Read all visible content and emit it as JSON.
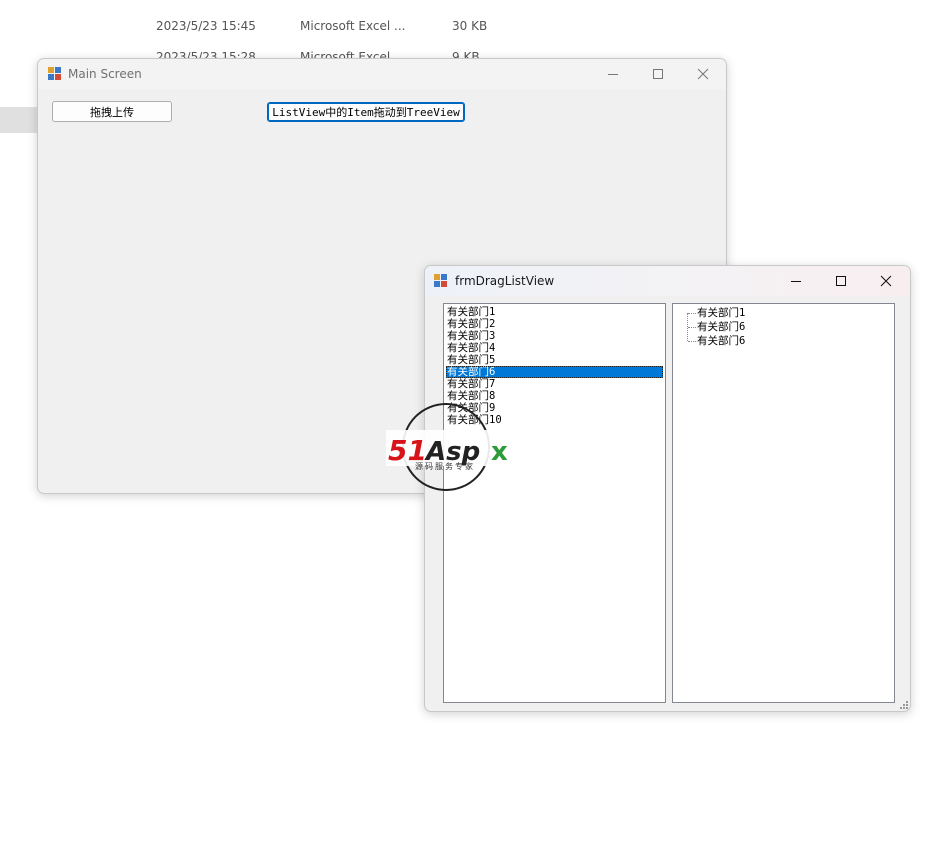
{
  "background_explorer": {
    "rows": [
      {
        "date": "2023/5/23 15:45",
        "type": "Microsoft Excel ...",
        "size": "30 KB"
      },
      {
        "date": "2023/5/23 15:28",
        "type": "Microsoft Excel ...",
        "size": "9 KB"
      }
    ]
  },
  "main_window": {
    "title": "Main Screen",
    "buttons": {
      "drag_upload": "拖拽上传",
      "listview_to_treeview": "ListView中的Item拖动到TreeView"
    }
  },
  "drag_window": {
    "title": "frmDragListView",
    "listview": {
      "items": [
        "有关部门1",
        "有关部门2",
        "有关部门3",
        "有关部门4",
        "有关部门5",
        "有关部门6",
        "有关部门7",
        "有关部门8",
        "有关部门9",
        "有关部门10"
      ],
      "selected_index": 5
    },
    "treeview": {
      "nodes": [
        "有关部门1",
        "有关部门6",
        "有关部门6"
      ]
    }
  },
  "watermark": {
    "logo_text": "51Aspx",
    "tagline": "源码服务专家"
  },
  "colors": {
    "selection": "#0078d7",
    "focus_border": "#0067c0",
    "window_bg": "#f0f0f0",
    "logo_red": "#d7141a",
    "logo_green": "#2e9b3a"
  },
  "icons": {
    "app": "winforms-app-icon",
    "minimize": "minimize-icon",
    "maximize": "maximize-icon",
    "close": "close-icon"
  }
}
